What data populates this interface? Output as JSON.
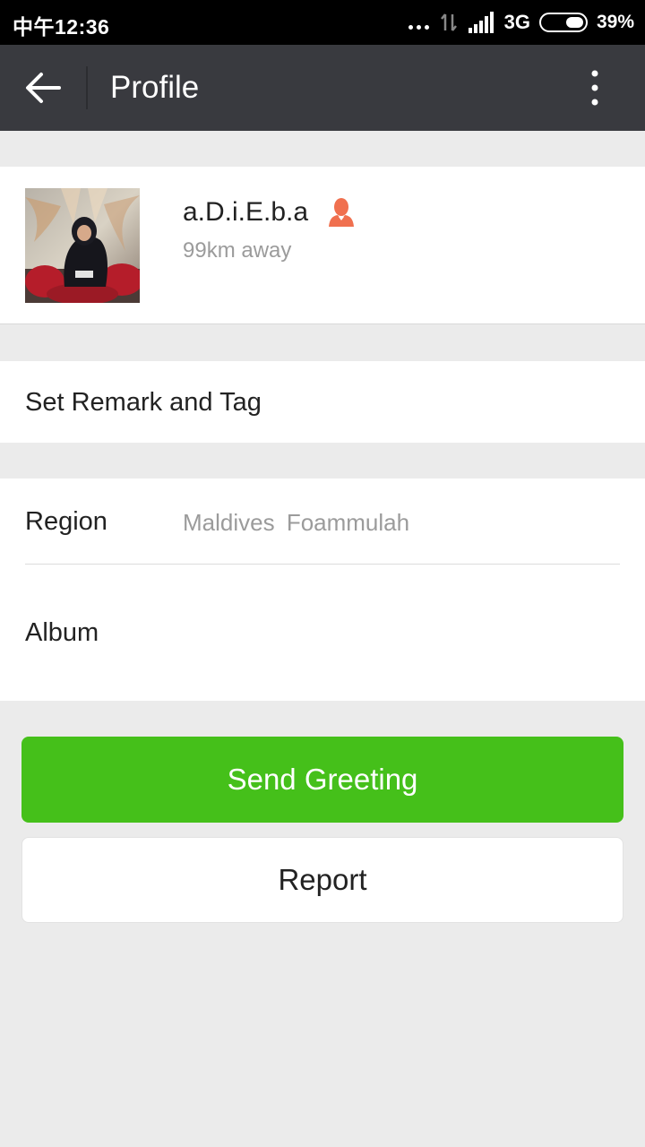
{
  "status_bar": {
    "time": "中午12:36",
    "network": "3G",
    "battery": "39%",
    "battery_level": 0.39
  },
  "app_bar": {
    "title": "Profile",
    "back_icon": "arrow-left-icon",
    "menu_icon": "more-vertical-icon"
  },
  "profile": {
    "nickname": "a.D.i.E.b.a",
    "distance": "99km away",
    "gender_icon": "female-icon",
    "gender_color": "#f0704f"
  },
  "remark": {
    "label": "Set Remark and Tag"
  },
  "info": {
    "region_label": "Region",
    "region_value": "Maldives  Foammulah",
    "album_label": "Album"
  },
  "actions": {
    "send_greeting": "Send Greeting",
    "report": "Report",
    "primary_color": "#45c01a"
  }
}
